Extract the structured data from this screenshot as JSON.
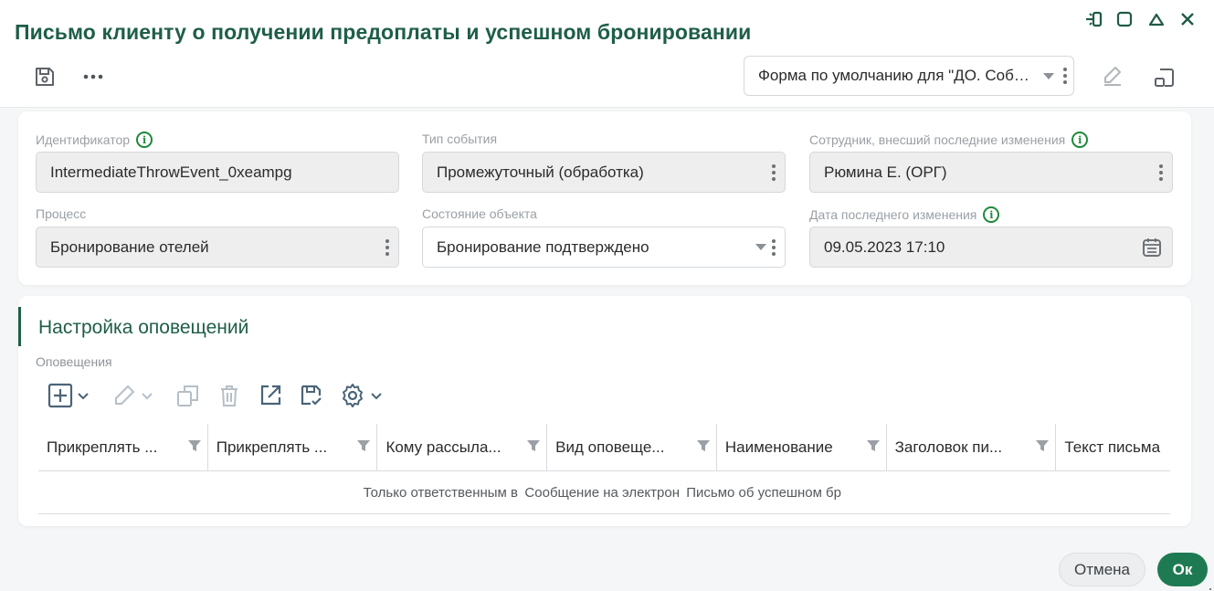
{
  "window": {
    "title": "Письмо клиенту о получении предоплаты и успешном бронировании"
  },
  "header": {
    "form_select_value": "Форма по умолчанию для \"ДО. Событие процесса\""
  },
  "fields": {
    "identifier": {
      "label": "Идентификатор",
      "value": "IntermediateThrowEvent_0xeampg"
    },
    "event_type": {
      "label": "Тип события",
      "value": "Промежуточный (обработка)"
    },
    "last_editor": {
      "label": "Сотрудник, внесший последние изменения",
      "value": "Рюмина Е. (ОРГ)"
    },
    "process": {
      "label": "Процесс",
      "value": "Бронирование отелей"
    },
    "object_state": {
      "label": "Состояние объекта",
      "value": "Бронирование подтверждено"
    },
    "last_modified": {
      "label": "Дата последнего изменения",
      "value": "09.05.2023 17:10"
    }
  },
  "notifications": {
    "section_title": "Настройка оповещений",
    "table_label": "Оповещения",
    "columns": [
      "Прикреплять ...",
      "Прикреплять ...",
      "Кому рассыла...",
      "Вид оповеще...",
      "Наименование",
      "Заголовок пи...",
      "Текст письма"
    ],
    "rows": [
      [
        "",
        "",
        "Только ответственным в",
        "Сообщение на электрон",
        "Письмо об успешном бр",
        "",
        ""
      ]
    ]
  },
  "footer": {
    "cancel_label": "Отмена",
    "ok_label": "Ок"
  },
  "colors": {
    "brand_green": "#1e5e48",
    "ok_button": "#1e7a52",
    "info_icon": "#1d8a3a"
  }
}
